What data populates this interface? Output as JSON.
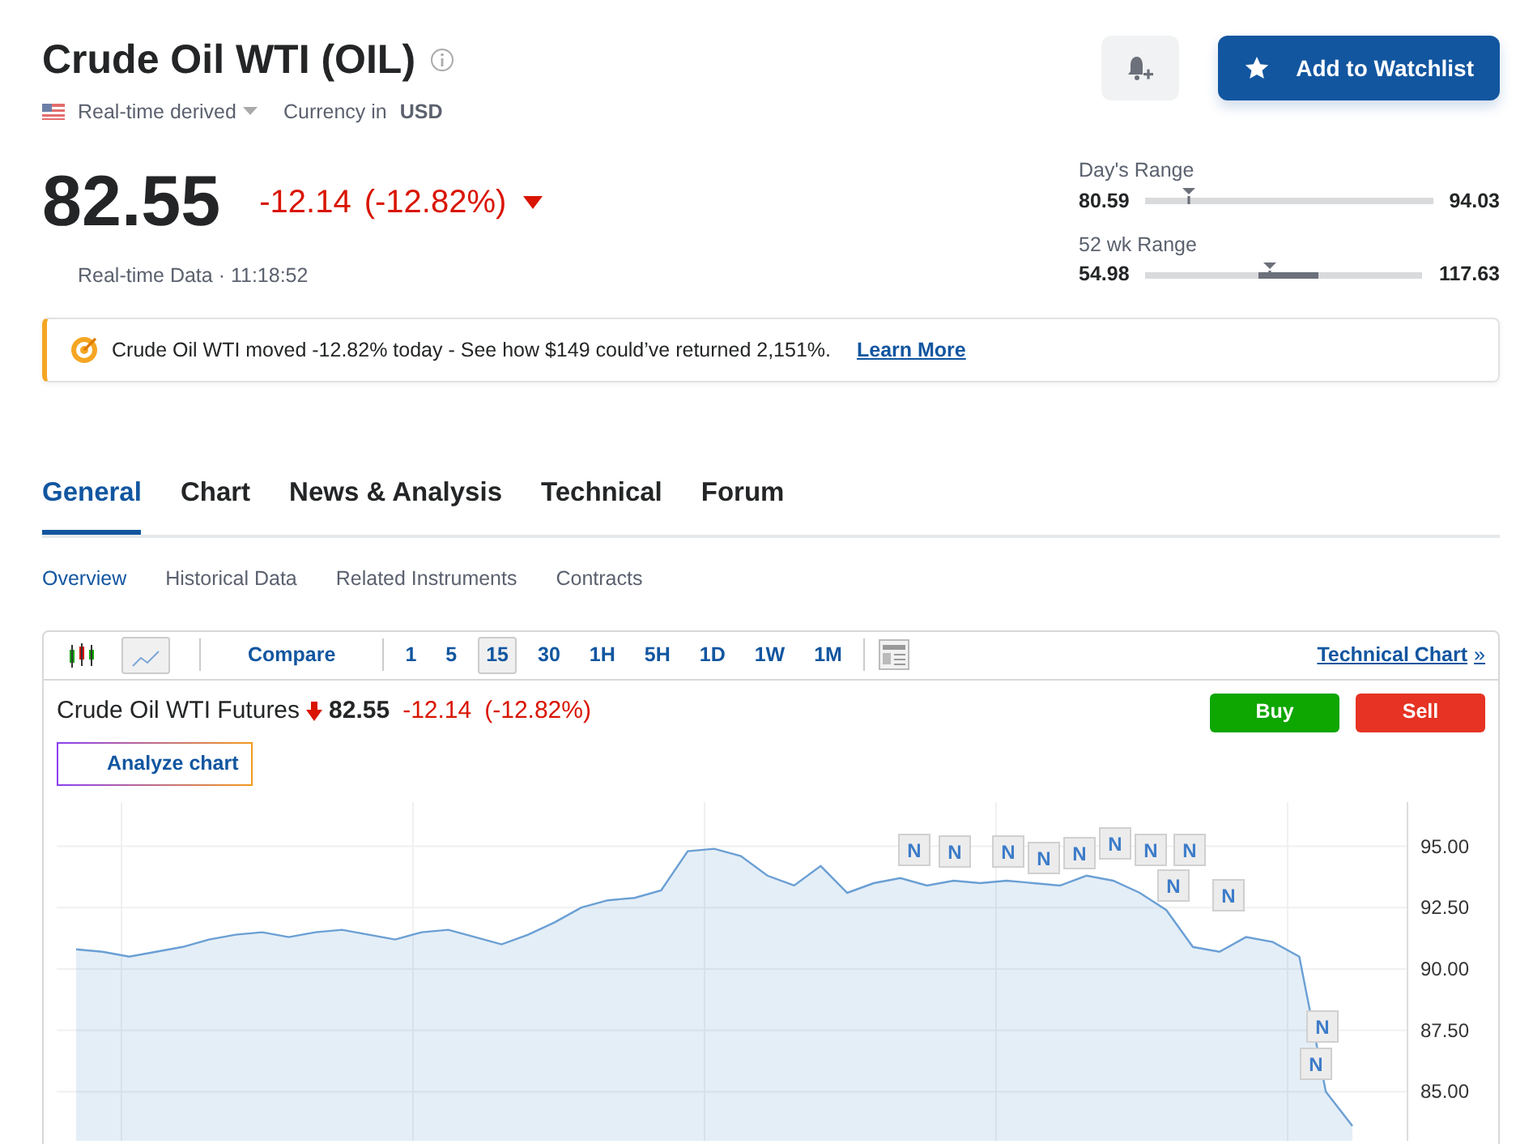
{
  "header": {
    "title": "Crude Oil WTI (OIL)",
    "source": "Real-time derived",
    "currency_label": "Currency in",
    "currency": "USD"
  },
  "quote": {
    "price": "82.55",
    "change": "-12.14",
    "change_pct": "(-12.82%)",
    "time": "Real-time Data · 11:18:52"
  },
  "watchlist_button": "Add to Watchlist",
  "ranges": [
    {
      "label": "Day's Range",
      "low": "80.59",
      "high": "94.03",
      "level": 0.15
    },
    {
      "label": "52 wk Range",
      "low": "54.98",
      "high": "117.63",
      "level": 0.45
    }
  ],
  "banner": {
    "text": "Crude Oil WTI moved -12.82% today - See how $149 could’ve returned 2,151%.",
    "link": "Learn More"
  },
  "tabs": [
    {
      "label": "General",
      "selected": true
    },
    {
      "label": "Chart",
      "selected": false
    },
    {
      "label": "News & Analysis",
      "selected": false
    },
    {
      "label": "Technical",
      "selected": false
    },
    {
      "label": "Forum",
      "selected": false
    }
  ],
  "subtabs": [
    {
      "label": "Overview",
      "selected": true
    },
    {
      "label": "Historical Data",
      "selected": false
    },
    {
      "label": "Related Instruments",
      "selected": false
    },
    {
      "label": "Contracts",
      "selected": false
    }
  ],
  "chart_toolbar": {
    "chart_types": [
      {
        "kind": "candles",
        "selected": false
      },
      {
        "kind": "area",
        "selected": true
      }
    ],
    "compare": "Compare",
    "intervals": [
      {
        "label": "1",
        "selected": false
      },
      {
        "label": "5",
        "selected": false
      },
      {
        "label": "15",
        "selected": true
      },
      {
        "label": "30",
        "selected": false
      },
      {
        "label": "1H",
        "selected": false
      },
      {
        "label": "5H",
        "selected": false
      },
      {
        "label": "1D",
        "selected": false
      },
      {
        "label": "1W",
        "selected": false
      },
      {
        "label": "1M",
        "selected": false
      }
    ],
    "technical_link": "Technical Chart",
    "technical_arrow": "»"
  },
  "chart_header": {
    "name": "Crude Oil WTI Futures",
    "price": "82.55",
    "change": "-12.14",
    "change_pct": "(-12.82%)",
    "analyze_button": "Analyze chart",
    "buy_button": "Buy",
    "sell_button": "Sell"
  },
  "chart_data": {
    "type": "area",
    "grid": true,
    "ylim": [
      83,
      96.8
    ],
    "yticks": [
      {
        "value": 85,
        "label": "85.00"
      },
      {
        "value": 87.5,
        "label": "87.50"
      },
      {
        "value": 90,
        "label": "90.00"
      },
      {
        "value": 92.5,
        "label": "92.50"
      },
      {
        "value": 95,
        "label": "95.00"
      }
    ],
    "series": [
      {
        "color": "#6a9fd4",
        "values": [
          90.8,
          90.7,
          90.5,
          90.7,
          90.9,
          91.2,
          91.4,
          91.5,
          91.3,
          91.5,
          91.6,
          91.4,
          91.2,
          91.5,
          91.6,
          91.3,
          91.0,
          91.4,
          91.9,
          92.5,
          92.8,
          92.9,
          93.2,
          94.8,
          94.9,
          94.6,
          93.8,
          93.4,
          94.2,
          93.1,
          93.5,
          93.7,
          93.4,
          93.6,
          93.5,
          93.6,
          93.5,
          93.4,
          93.8,
          93.6,
          93.1,
          92.4,
          90.9,
          90.7,
          91.3,
          91.1,
          90.5,
          85.0,
          83.6
        ]
      }
    ]
  },
  "news_flags": [
    "N",
    "N",
    "N",
    "N",
    "N",
    "N",
    "N",
    "N",
    "N",
    "N",
    "N",
    "N"
  ]
}
